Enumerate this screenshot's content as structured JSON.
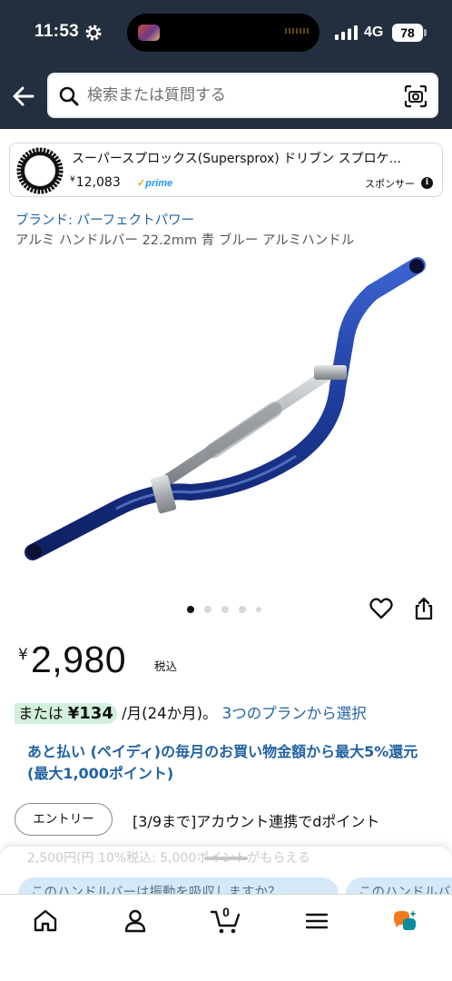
{
  "status_bar": {
    "time": "11:53",
    "network": "4G",
    "battery": "78"
  },
  "search": {
    "placeholder": "検索または質問する"
  },
  "sponsored": {
    "title": "スーパースプロックス(Supersprox) ドリブン スプロケ...",
    "price_symbol": "¥",
    "price": "12,083",
    "prime_label": "prime",
    "label": "スポンサー"
  },
  "product": {
    "brand_link": "ブランド: パーフェクトパワー",
    "title": "アルミ ハンドルバー 22.2mm 青 ブルー アルミハンドル",
    "image_icon": "blue-handlebar-image",
    "carousel": {
      "total": 5,
      "active": 0
    },
    "price_symbol": "¥",
    "price": "2,980",
    "tax_label": "税込"
  },
  "installment": {
    "prefix": "または ",
    "amount": "¥134",
    "suffix": " /月(24か月)。",
    "plans_link": "3つのプランから選択"
  },
  "paidy_promo": "あと払い (ペイディ)の毎月のお買い物金額から最大5%還元 (最大1,000ポイント)",
  "entry": {
    "button_label": "エントリー",
    "text": "[3/9まで]アカウント連携でdポイント"
  },
  "bottom_sheet": {
    "ghost_text": "2,500円(円 10%税込: 5,000ポイントがもらえる",
    "chips": [
      "このハンドルバーは振動を吸収しますか？",
      "このハンドルバーは"
    ]
  },
  "tab_bar": {
    "items": [
      "home-icon",
      "account-icon",
      "cart-icon",
      "menu-icon",
      "rufus-icon"
    ],
    "cart_count": "0"
  },
  "colors": {
    "header_bg": "#232f3e",
    "link": "#2162a1",
    "handlebar_blue": "#1f3fa0",
    "installment_highlight": "#d2f0dc",
    "chip_bg": "#d6e9f9",
    "rufus_orange": "#f27a1a",
    "rufus_teal": "#0e8a9c"
  }
}
